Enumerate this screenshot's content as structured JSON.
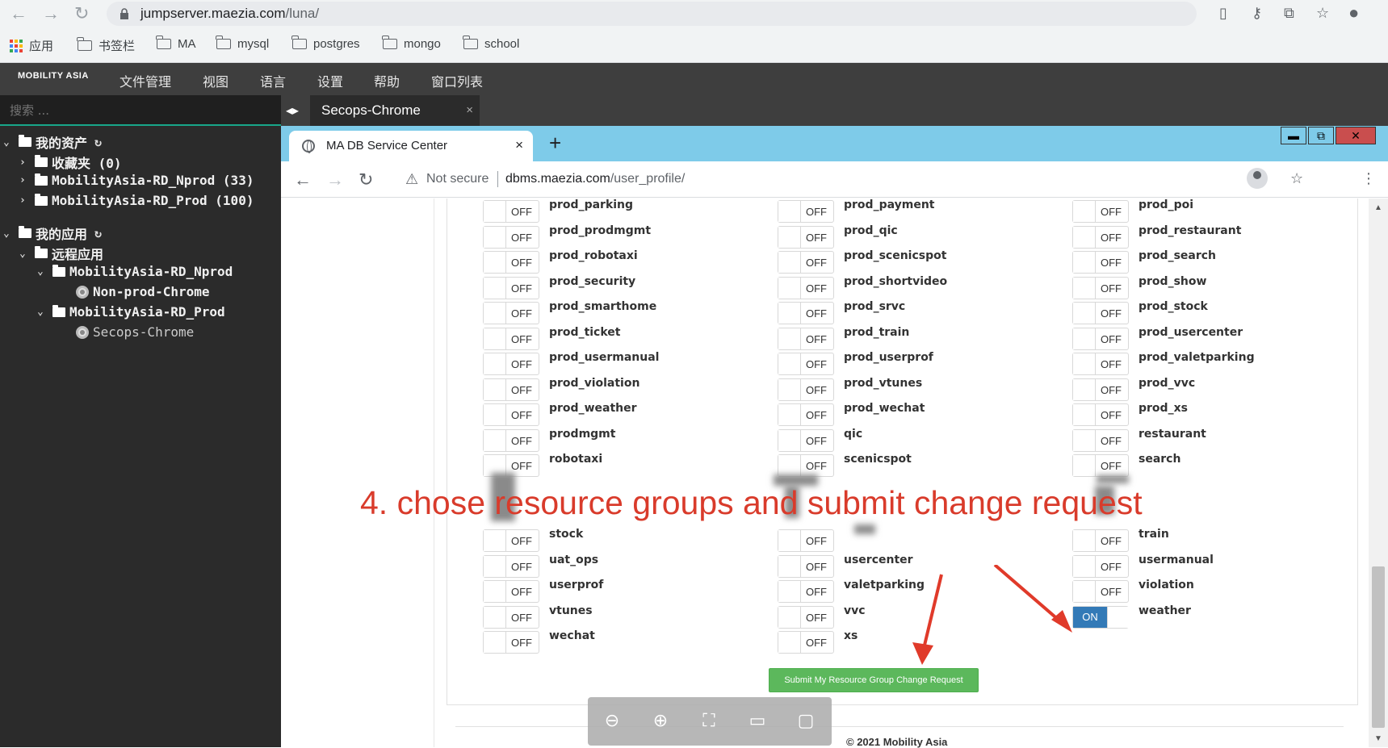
{
  "outer_browser": {
    "url_host": "jumpserver.maezia.com",
    "url_path": "/luna/",
    "bookmarks": [
      "应用",
      "书签栏",
      "MA",
      "mysql",
      "postgres",
      "mongo",
      "school"
    ]
  },
  "jumpserver": {
    "logo": "MOBILITY ASIA",
    "menu": [
      "文件管理",
      "视图",
      "语言",
      "设置",
      "帮助",
      "窗口列表"
    ],
    "search_placeholder": "搜索 ...",
    "tab_label": "Secops-Chrome",
    "tab_close": "×",
    "tree": {
      "my_assets": "我的资产",
      "favorites": "收藏夹 (0)",
      "nprod_assets": "MobilityAsia-RD_Nprod (33)",
      "prod_assets": "MobilityAsia-RD_Prod (100)",
      "my_apps": "我的应用",
      "remote_apps": "远程应用",
      "nprod_group": "MobilityAsia-RD_Nprod",
      "nprod_chrome": "Non-prod-Chrome",
      "prod_group": "MobilityAsia-RD_Prod",
      "prod_chrome": "Secops-Chrome"
    }
  },
  "inner_browser": {
    "tab_title": "MA DB Service Center",
    "tab_close": "×",
    "new_tab": "+",
    "security_label": "Not secure",
    "url_host": "dbms.maezia.com",
    "url_path": "/user_profile/"
  },
  "page": {
    "toggle_off": "OFF",
    "toggle_on": "ON",
    "columns": [
      [
        "prod_parking",
        "prod_prodmgmt",
        "prod_robotaxi",
        "prod_security",
        "prod_smarthome",
        "prod_ticket",
        "prod_usermanual",
        "prod_violation",
        "prod_weather",
        "prodmgmt",
        "robotaxi"
      ],
      [
        "prod_payment",
        "prod_qic",
        "prod_scenicspot",
        "prod_shortvideo",
        "prod_srvc",
        "prod_train",
        "prod_userprof",
        "prod_vtunes",
        "prod_wechat",
        "qic",
        "scenicspot"
      ],
      [
        "prod_poi",
        "prod_restaurant",
        "prod_search",
        "prod_show",
        "prod_stock",
        "prod_usercenter",
        "prod_valetparking",
        "prod_vvc",
        "prod_xs",
        "restaurant",
        "search"
      ]
    ],
    "lower_columns": [
      [
        "stock",
        "uat_ops",
        "userprof",
        "vtunes",
        "wechat"
      ],
      [
        "",
        "usercenter",
        "valetparking",
        "vvc",
        "xs"
      ],
      [
        "train",
        "usermanual",
        "violation",
        "weather"
      ]
    ],
    "weather_state": "ON",
    "annotation": "4. chose resource groups and submit change request",
    "submit_button": "Submit My Resource Group Change Request",
    "footer": "© 2021 Mobility Asia"
  },
  "colors": {
    "accent_on": "#337ab7",
    "submit_green": "#5cb85c",
    "annotation_red": "#d93b2b",
    "inner_titlebar": "#7ecbe9"
  }
}
